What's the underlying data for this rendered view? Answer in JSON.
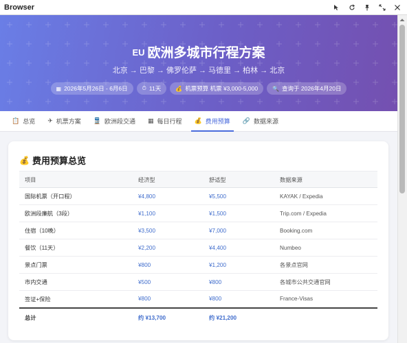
{
  "window": {
    "title": "Browser"
  },
  "hero": {
    "flag": "EU",
    "title": "欧洲多城市行程方案",
    "route": "北京 → 巴黎 → 佛罗伦萨 → 马德里 → 柏林 → 北京",
    "pills": [
      {
        "icon": "calendar-icon",
        "glyph": "▦",
        "label": "2026年5月26日 - 6月6日"
      },
      {
        "icon": "stopwatch-icon",
        "glyph": "⏱",
        "label": "11天"
      },
      {
        "icon": "money-icon",
        "glyph": "💰",
        "label": "机票预算 机票 ¥3,000-5,000"
      },
      {
        "icon": "magnifier-icon",
        "glyph": "🔍",
        "label": "查询于 2026年4月20日"
      }
    ]
  },
  "tabs": [
    {
      "name": "tab-overview",
      "icon": "clipboard-icon",
      "glyph": "📋",
      "label": "总览",
      "active": false
    },
    {
      "name": "tab-flights",
      "icon": "airplane-icon",
      "glyph": "✈",
      "label": "机票方案",
      "active": false
    },
    {
      "name": "tab-europe-transport",
      "icon": "train-icon",
      "glyph": "🚆",
      "label": "欧洲段交通",
      "active": false
    },
    {
      "name": "tab-daily-itinerary",
      "icon": "calendar-icon",
      "glyph": "▦",
      "label": "每日行程",
      "active": false
    },
    {
      "name": "tab-budget",
      "icon": "money-bag-icon",
      "glyph": "💰",
      "label": "费用预算",
      "active": true
    },
    {
      "name": "tab-data-sources",
      "icon": "link-icon",
      "glyph": "🔗",
      "label": "数据来源",
      "active": false
    }
  ],
  "budget": {
    "title": "费用预算总览",
    "headers": [
      "项目",
      "经济型",
      "舒适型",
      "数据来源"
    ],
    "rows": [
      [
        "国际机票（开口程）",
        "¥4,800",
        "¥5,500",
        "KAYAK / Expedia"
      ],
      [
        "欧洲段廉航（3段）",
        "¥1,100",
        "¥1,500",
        "Trip.com / Expedia"
      ],
      [
        "住宿（10晚）",
        "¥3,500",
        "¥7,000",
        "Booking.com"
      ],
      [
        "餐饮（11天）",
        "¥2,200",
        "¥4,400",
        "Numbeo"
      ],
      [
        "景点门票",
        "¥800",
        "¥1,200",
        "各景点官网"
      ],
      [
        "市内交通",
        "¥500",
        "¥800",
        "各城市公共交通官网"
      ],
      [
        "签证+保险",
        "¥800",
        "¥800",
        "France-Visas"
      ]
    ],
    "total": [
      "总计",
      "约 ¥13,700",
      "约 ¥21,200",
      ""
    ]
  }
}
